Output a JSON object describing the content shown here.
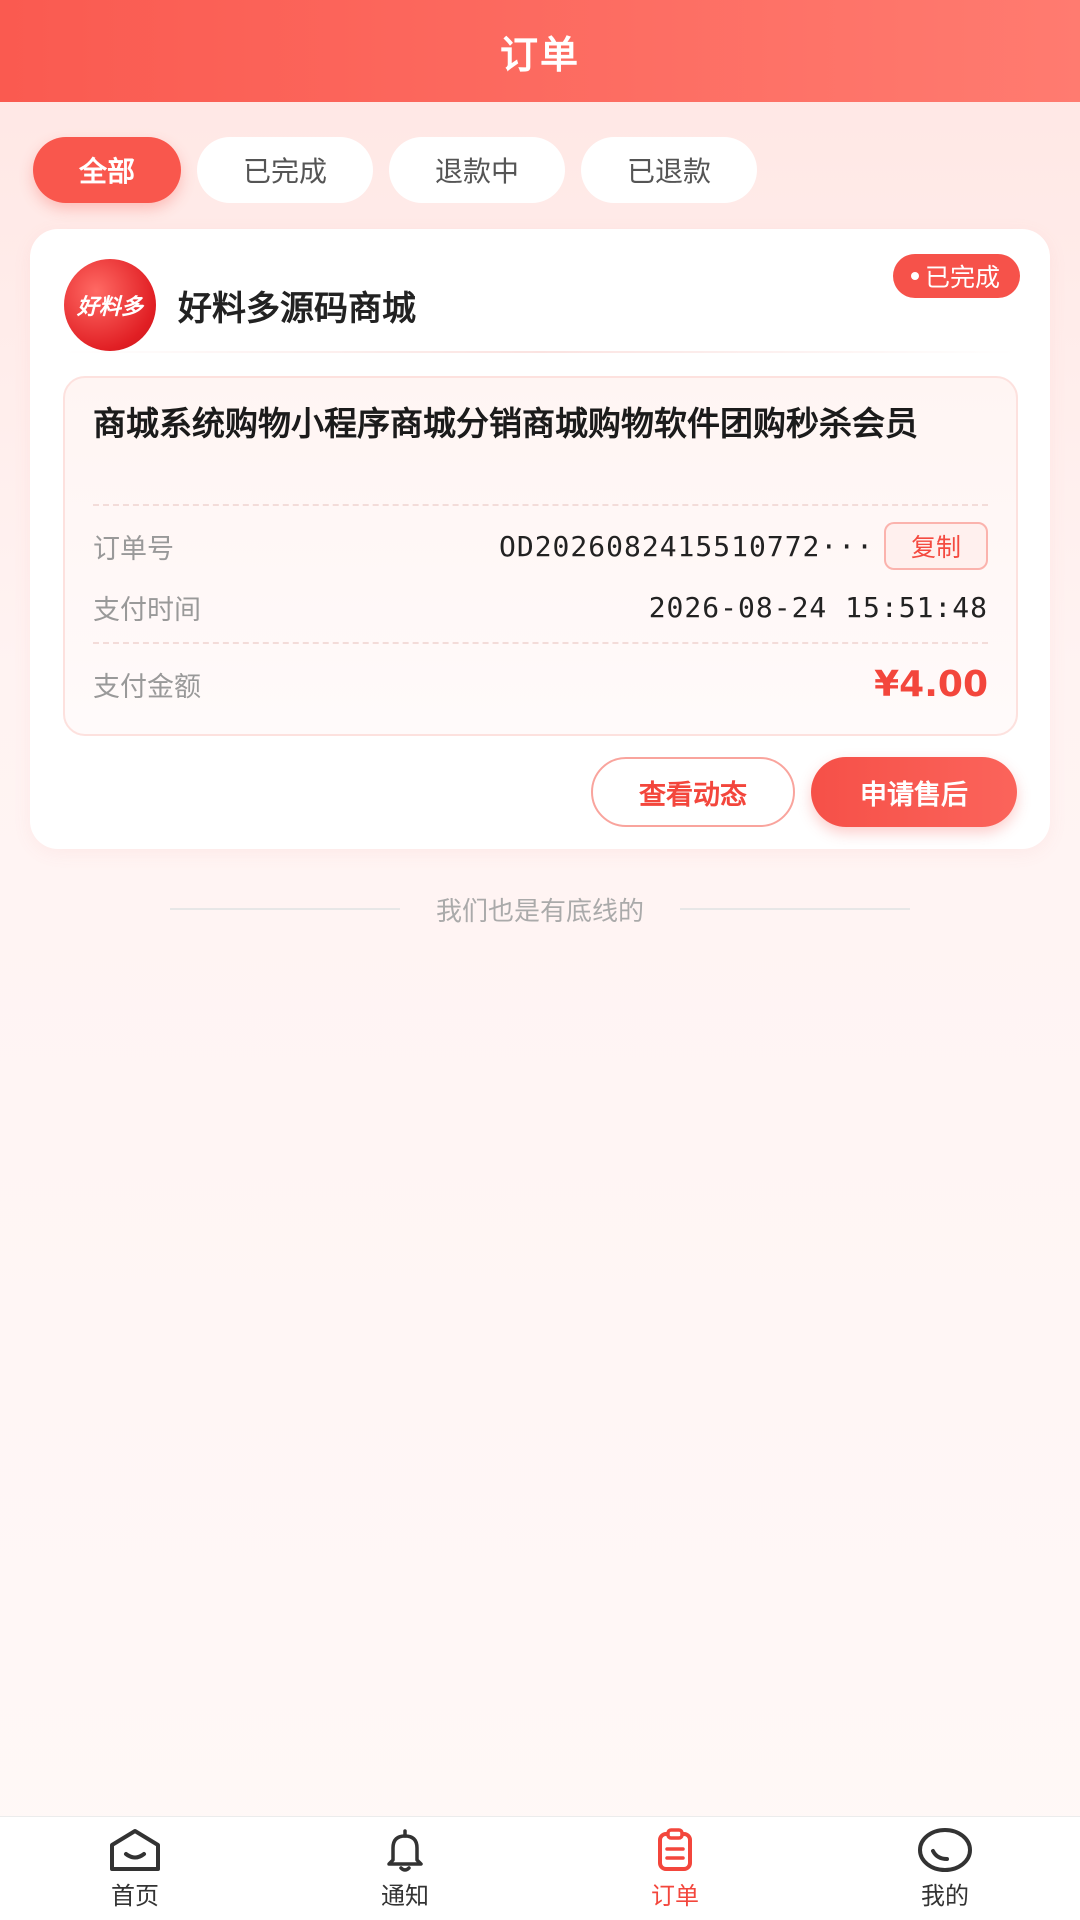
{
  "header": {
    "title": "订单"
  },
  "tabs": [
    {
      "label": "全部",
      "active": true
    },
    {
      "label": "已完成",
      "active": false
    },
    {
      "label": "退款中",
      "active": false
    },
    {
      "label": "已退款",
      "active": false
    }
  ],
  "order": {
    "shop_logo_text": "好料多",
    "shop_name": "好料多源码商城",
    "status": "已完成",
    "product_title": "商城系统购物小程序商城分销商城购物软件团购秒杀会员",
    "order_no_label": "订单号",
    "order_no": "OD2026082415510772···",
    "copy_label": "复制",
    "pay_time_label": "支付时间",
    "pay_time": "2026-08-24 15:51:48",
    "amount_label": "支付金额",
    "amount": "¥4.00",
    "view_button": "查看动态",
    "aftersale_button": "申请售后"
  },
  "end_text": "我们也是有底线的",
  "tabbar": [
    {
      "label": "首页",
      "icon": "home-icon"
    },
    {
      "label": "通知",
      "icon": "bell-icon"
    },
    {
      "label": "订单",
      "icon": "order-icon",
      "active": true
    },
    {
      "label": "我的",
      "icon": "user-icon"
    }
  ],
  "colors": {
    "accent": "#f9574d",
    "price": "#f3463c"
  }
}
